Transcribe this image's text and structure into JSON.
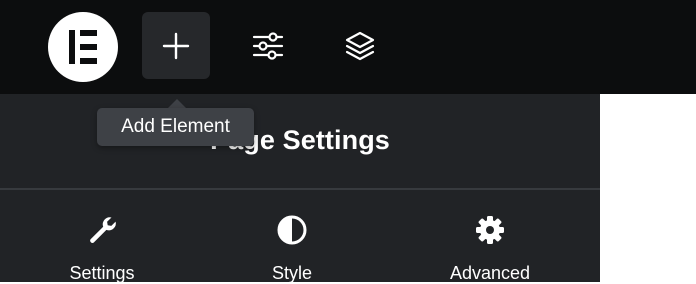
{
  "toolbar": {
    "logo_icon": "elementor-logo-icon",
    "buttons": [
      {
        "name": "add-element-button",
        "icon": "plus-icon",
        "active": true
      },
      {
        "name": "page-settings-button",
        "icon": "sliders-icon",
        "active": false
      },
      {
        "name": "structure-button",
        "icon": "layers-icon",
        "active": false
      }
    ]
  },
  "tooltip": {
    "text": "Add Element"
  },
  "panel": {
    "title": "Page Settings",
    "tabs": [
      {
        "label": "Settings",
        "icon": "wrench-icon"
      },
      {
        "label": "Style",
        "icon": "half-circle-icon"
      },
      {
        "label": "Advanced",
        "icon": "gear-icon"
      }
    ]
  },
  "colors": {
    "topbar_bg": "#0c0d0e",
    "panel_bg": "#212326",
    "tooltip_bg": "#3e4146",
    "active_button_bg": "#26282b",
    "canvas_bg": "#ffffff"
  }
}
